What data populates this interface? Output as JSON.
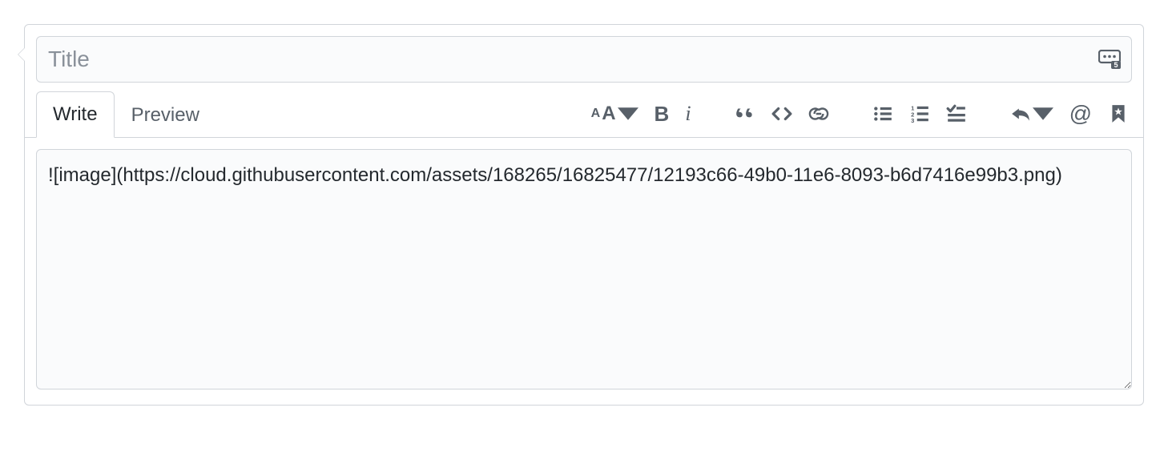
{
  "form": {
    "title_placeholder": "Title",
    "title_value": "",
    "body_value": "![image](https://cloud.githubusercontent.com/assets/168265/16825477/12193c66-49b0-11e6-8093-b6d7416e99b3.png)"
  },
  "tabs": {
    "write": "Write",
    "preview": "Preview",
    "active": "write"
  },
  "toolbar": {
    "heading": "Heading",
    "bold": "B",
    "italic": "i",
    "quote": "Quote",
    "code": "Code",
    "link": "Link",
    "ul": "Bulleted list",
    "ol": "Numbered list",
    "task": "Task list",
    "reply": "Reply",
    "mention": "@",
    "reference": "Reference"
  }
}
